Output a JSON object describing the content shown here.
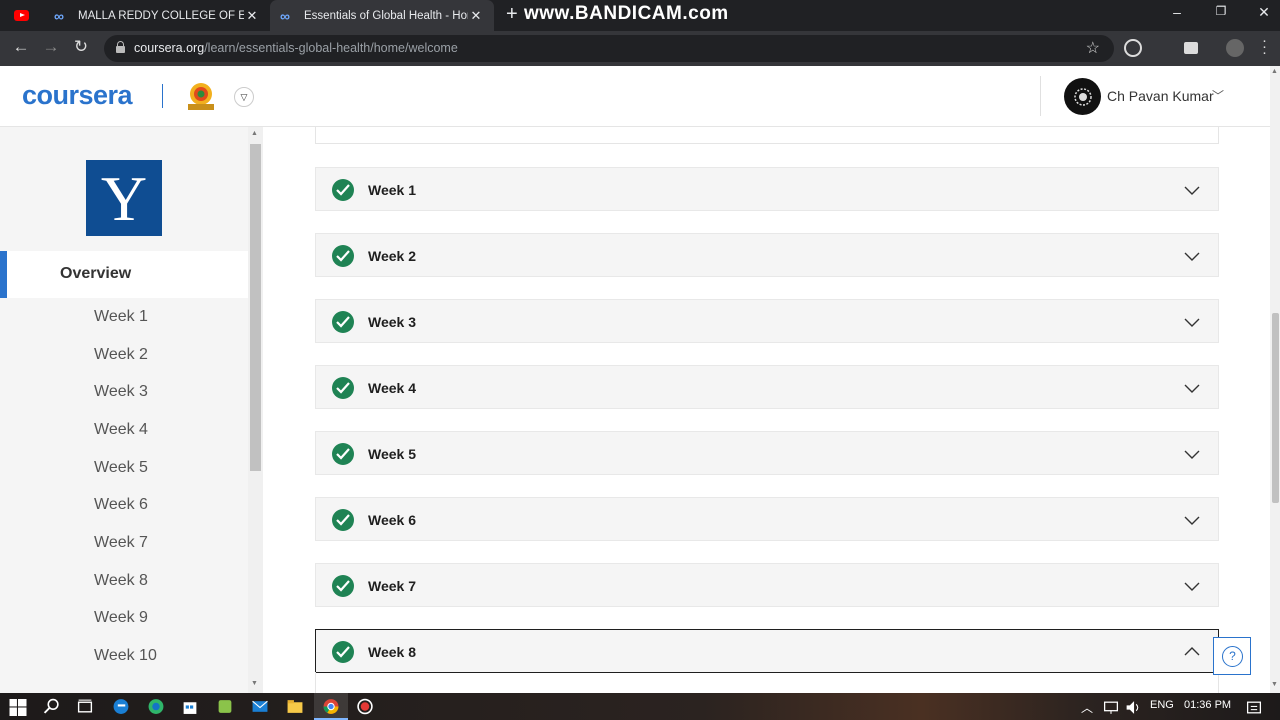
{
  "browser": {
    "tabs": [
      {
        "title": "",
        "icon": "youtube-icon"
      },
      {
        "title": "MALLA REDDY COLLEGE OF ENG",
        "icon": "coursera-infinity-icon"
      },
      {
        "title": "Essentials of Global Health - Hon",
        "icon": "coursera-infinity-icon",
        "active": true
      }
    ],
    "new_tab_symbol": "+",
    "watermark": "www.BANDICAM.com",
    "url_host": "coursera.org",
    "url_path": "/learn/essentials-global-health/home/welcome",
    "window_controls": {
      "minimize": "–",
      "restore": "❐",
      "close": "✕"
    }
  },
  "header": {
    "logo_text": "coursera",
    "user_name": "Ch Pavan Kumar",
    "brand_color": "#2a73cc"
  },
  "sidebar": {
    "university_logo_letter": "Y",
    "overview_label": "Overview",
    "items": [
      "Week 1",
      "Week 2",
      "Week 3",
      "Week 4",
      "Week 5",
      "Week 6",
      "Week 7",
      "Week 8",
      "Week 9",
      "Week 10"
    ]
  },
  "main": {
    "weeks": [
      {
        "label": "Week 1",
        "completed": true,
        "expanded": false
      },
      {
        "label": "Week 2",
        "completed": true,
        "expanded": false
      },
      {
        "label": "Week 3",
        "completed": true,
        "expanded": false
      },
      {
        "label": "Week 4",
        "completed": true,
        "expanded": false
      },
      {
        "label": "Week 5",
        "completed": true,
        "expanded": false
      },
      {
        "label": "Week 6",
        "completed": true,
        "expanded": false
      },
      {
        "label": "Week 7",
        "completed": true,
        "expanded": false
      },
      {
        "label": "Week 8",
        "completed": true,
        "expanded": true
      }
    ],
    "check_color": "#1f8354",
    "help_symbol": "?"
  },
  "taskbar": {
    "language": "ENG",
    "time": "01:36 PM"
  }
}
